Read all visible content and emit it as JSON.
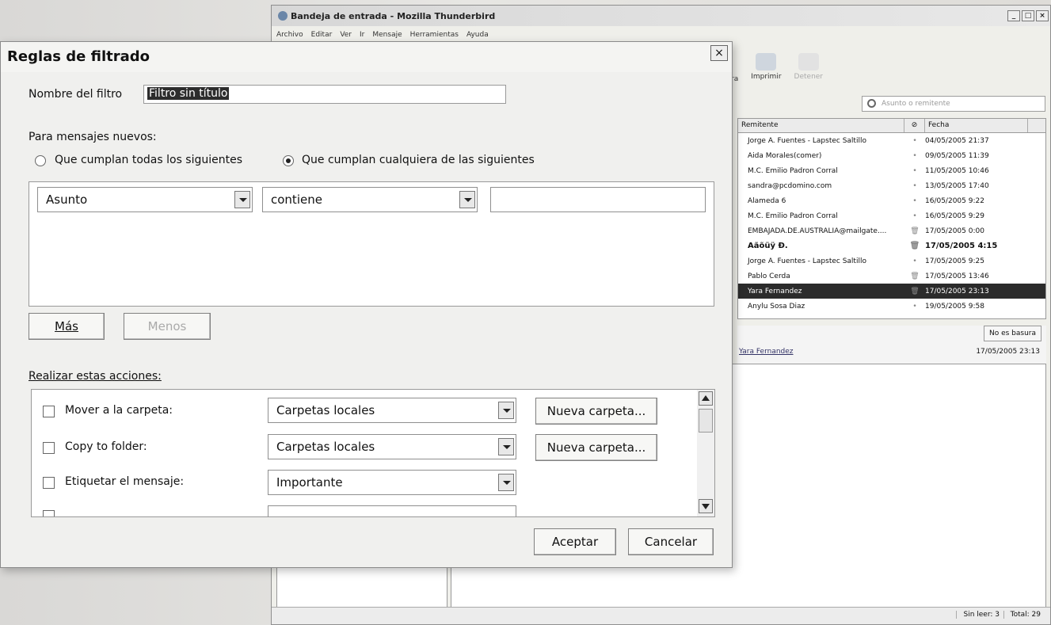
{
  "thunderbird": {
    "title": "Bandeja de entrada - Mozilla Thunderbird",
    "window_controls": [
      "_",
      "□",
      "×"
    ],
    "menu": [
      "Archivo",
      "Editar",
      "Ver",
      "Ir",
      "Mensaje",
      "Herramientas",
      "Ayuda"
    ],
    "toolbar": {
      "left_fragment": "ra",
      "print": "Imprimir",
      "stop": "Detener"
    },
    "search_placeholder": "Asunto o remitente",
    "list_headers": {
      "sender": "Remitente",
      "date": "Fecha"
    },
    "messages": [
      {
        "sender": "Jorge A. Fuentes - Lapstec Saltillo",
        "date": "04/05/2005 21:37"
      },
      {
        "sender": "Aida Morales(comer)",
        "date": "09/05/2005 11:39"
      },
      {
        "sender": "M.C. Emilio Padron Corral",
        "date": "11/05/2005 10:46"
      },
      {
        "sender": "sandra@pcdomino.com",
        "date": "13/05/2005 17:40"
      },
      {
        "sender": "Alameda 6",
        "date": "16/05/2005 9:22"
      },
      {
        "sender": "M.C. Emilio Padron Corral",
        "date": "16/05/2005 9:29"
      },
      {
        "sender": "EMBAJADA.DE.AUSTRALIA@mailgate....",
        "date": "17/05/2005 0:00"
      },
      {
        "sender": "Äãõüÿ Ð.",
        "date": "17/05/2005 4:15"
      },
      {
        "sender": "Jorge A. Fuentes - Lapstec Saltillo",
        "date": "17/05/2005 9:25"
      },
      {
        "sender": "Pablo Cerda",
        "date": "17/05/2005 13:46"
      },
      {
        "sender": "Yara Fernandez",
        "date": "17/05/2005 23:13"
      },
      {
        "sender": "Anylu Sosa Diaz",
        "date": "19/05/2005 9:58"
      }
    ],
    "junk_button": "No es basura",
    "preview_from": "Yara Fernandez",
    "preview_date": "17/05/2005 23:13",
    "status_unread": "Sin leer: 3",
    "status_total": "Total: 29"
  },
  "dialog": {
    "title": "Reglas de filtrado",
    "close": "×",
    "filter_name_label": "Nombre del filtro",
    "filter_name_value": "Filtro sin título",
    "new_messages_label": "Para mensajes nuevos:",
    "radio_all": "Que cumplan todas los siguientes",
    "radio_any": "Que cumplan cualquiera de las siguientes",
    "criterion_field": "Asunto",
    "criterion_op": "contiene",
    "more_button": "Más",
    "less_button": "Menos",
    "actions_label": "Realizar estas acciones:",
    "actions": [
      {
        "label": "Mover a la carpeta:",
        "value": "Carpetas locales",
        "button": "Nueva carpeta..."
      },
      {
        "label": "Copy to folder:",
        "value": "Carpetas locales",
        "button": "Nueva carpeta..."
      },
      {
        "label": "Etiquetar el mensaje:",
        "value": "Importante"
      }
    ],
    "ok_button": "Aceptar",
    "cancel_button": "Cancelar"
  }
}
